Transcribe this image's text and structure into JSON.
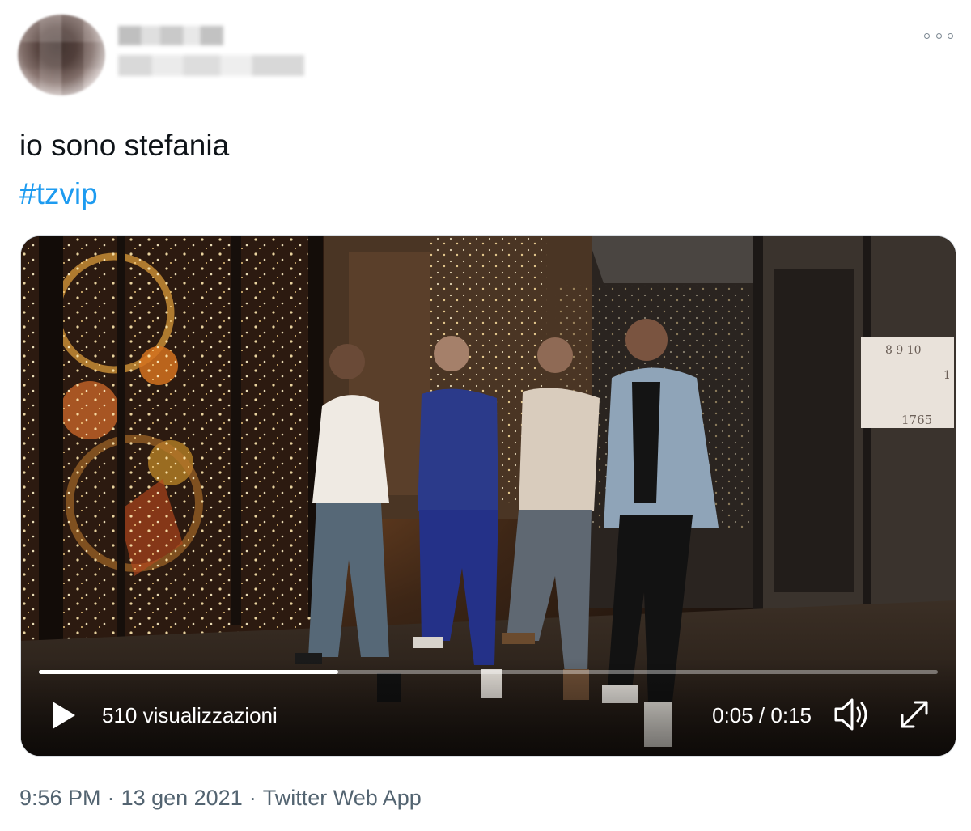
{
  "tweet": {
    "text": "io sono stefania",
    "hashtag": "#tzvip"
  },
  "header": {
    "more_icon": "more-horizontal-icon"
  },
  "video": {
    "views_label": "510 visualizzazioni",
    "time_display": "0:05 / 0:15",
    "progress_fraction": 0.3333,
    "play_icon": "play-icon",
    "volume_icon": "volume-icon",
    "fullscreen_icon": "fullscreen-icon",
    "scene_sign_text": [
      "8 9 10",
      "1",
      "1765"
    ]
  },
  "meta": {
    "time": "9:56 PM",
    "separator": "·",
    "date": "13 gen 2021",
    "source": "Twitter Web App"
  },
  "colors": {
    "link": "#1d9bf0",
    "meta_text": "#536471",
    "primary_text": "#0f1419"
  }
}
